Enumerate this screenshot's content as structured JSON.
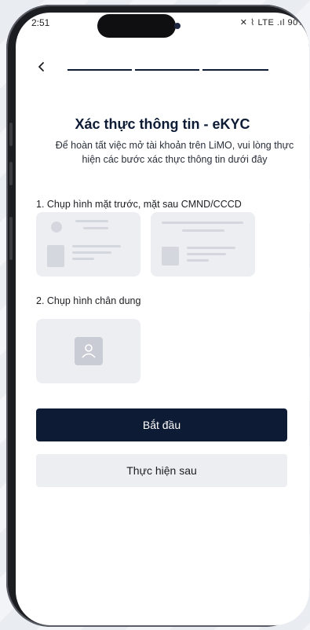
{
  "status_bar": {
    "time": "2:51",
    "indicators": "✕ ⌇ LTE .ıl 90%"
  },
  "nav": {
    "back_icon": "chevron-left-icon",
    "progress_steps": 3
  },
  "header": {
    "title": "Xác thực thông tin - eKYC",
    "subtitle": "Để hoàn tất việc mở tài khoản trên LiMO, vui lòng thực hiện các bước xác thực thông tin dưới đây"
  },
  "step1": {
    "label": "1. Chụp hình mặt trước, mặt sau CMND/CCCD",
    "front_icon": "id-card-front-icon",
    "back_icon": "id-card-back-icon"
  },
  "step2": {
    "label": "2. Chụp hình chân dung",
    "portrait_icon": "user-portrait-icon"
  },
  "actions": {
    "start_label": "Bắt đầu",
    "later_label": "Thực hiện sau"
  },
  "colors": {
    "primary": "#0d1b35",
    "secondary_bg": "#eceef2",
    "placeholder": "#d4d7de"
  }
}
